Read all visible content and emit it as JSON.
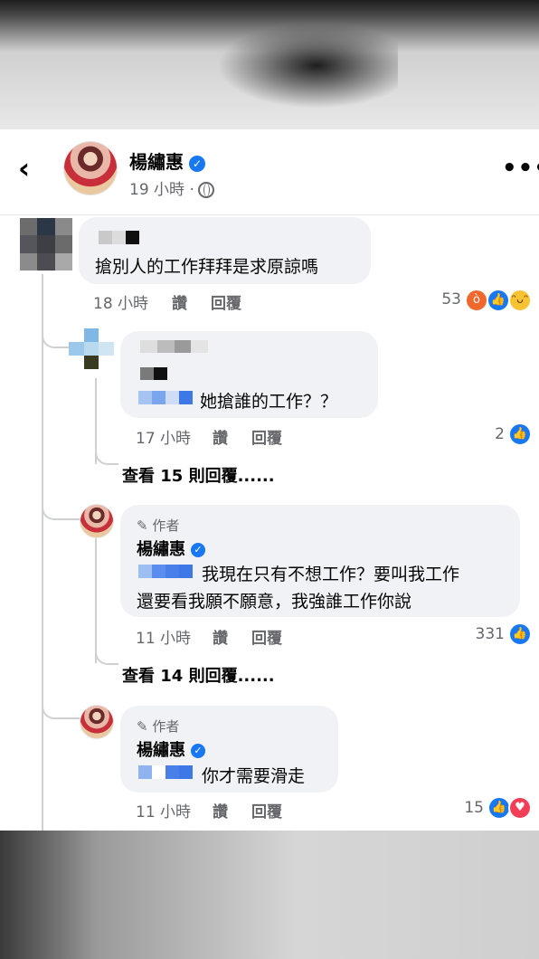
{
  "post": {
    "author": "楊繡惠",
    "time": "19 小時 ·",
    "back_icon": "‹",
    "more_icon": "•••"
  },
  "actions": {
    "like": "讚",
    "reply": "回覆"
  },
  "comments": [
    {
      "text": "搶別人的工作拜拜是求原諒嗎",
      "time": "18 小時",
      "reaction_count": "53",
      "reactions": [
        "angry",
        "like",
        "haha"
      ]
    },
    {
      "text": "她搶誰的工作？？",
      "time": "17 小時",
      "reaction_count": "2",
      "reactions": [
        "like"
      ],
      "more_replies": "查看 15 則回覆......"
    },
    {
      "author_tag": "作者",
      "author": "楊繡惠",
      "text_line1": "我現在只有不想工作？要叫我工作",
      "text_line2": "還要看我願不願意，我強誰工作你說",
      "time": "11 小時",
      "reaction_count": "331",
      "reactions": [
        "like"
      ],
      "more_replies": "查看 14 則回覆......"
    },
    {
      "author_tag": "作者",
      "author": "楊繡惠",
      "text": "你才需要滑走",
      "time": "11 小時",
      "reaction_count": "15",
      "reactions": [
        "like",
        "love"
      ]
    }
  ],
  "colors": {
    "verified": "#1877f2",
    "bubble": "#f0f2f5",
    "mask_blue": "#5b8def",
    "secondary_text": "#65676b"
  }
}
